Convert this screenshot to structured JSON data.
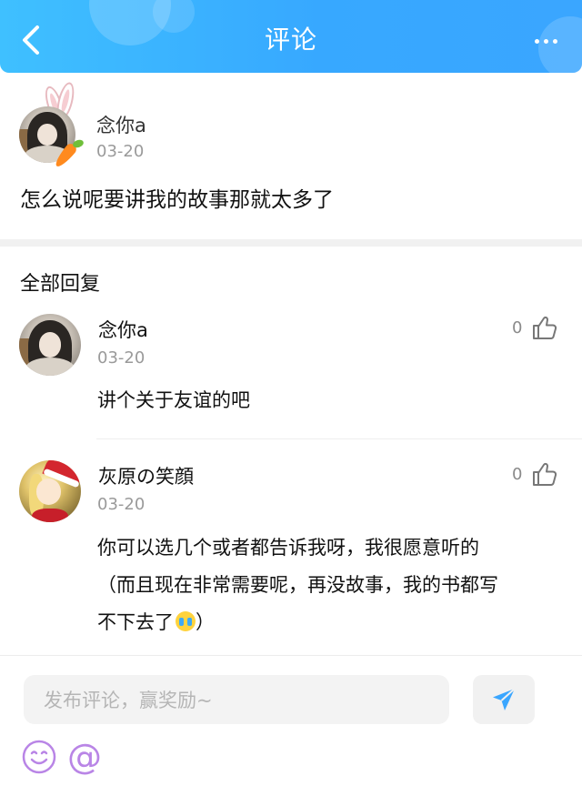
{
  "header": {
    "title": "评论",
    "back_icon": "chevron-left-icon",
    "more_icon": "more-dots-icon",
    "gradient_start": "#3fc0ff",
    "gradient_end": "#3aa6ff"
  },
  "main_comment": {
    "author": "念你a",
    "date": "03-20",
    "text": "怎么说呢要讲我的故事那就太多了"
  },
  "replies_section": {
    "title": "全部回复"
  },
  "replies": [
    {
      "author": "念你a",
      "date": "03-20",
      "likes": "0",
      "text_lines": [
        "讲个关于友谊的吧"
      ]
    },
    {
      "author": "灰原の笑顔",
      "date": "03-20",
      "likes": "0",
      "text_lines": [
        "你可以选几个或者都告诉我呀，我很愿意听的",
        "（而且现在非常需要呢，再没故事，我的书都写",
        "不下去了",
        "）"
      ]
    }
  ],
  "composer": {
    "placeholder": "发布评论，赢奖励~",
    "at_symbol": "@",
    "send_icon": "paper-plane-icon",
    "emoji_icon": "smiley-icon",
    "accent_color": "#3aa6ff",
    "tool_color": "#b985e6"
  }
}
